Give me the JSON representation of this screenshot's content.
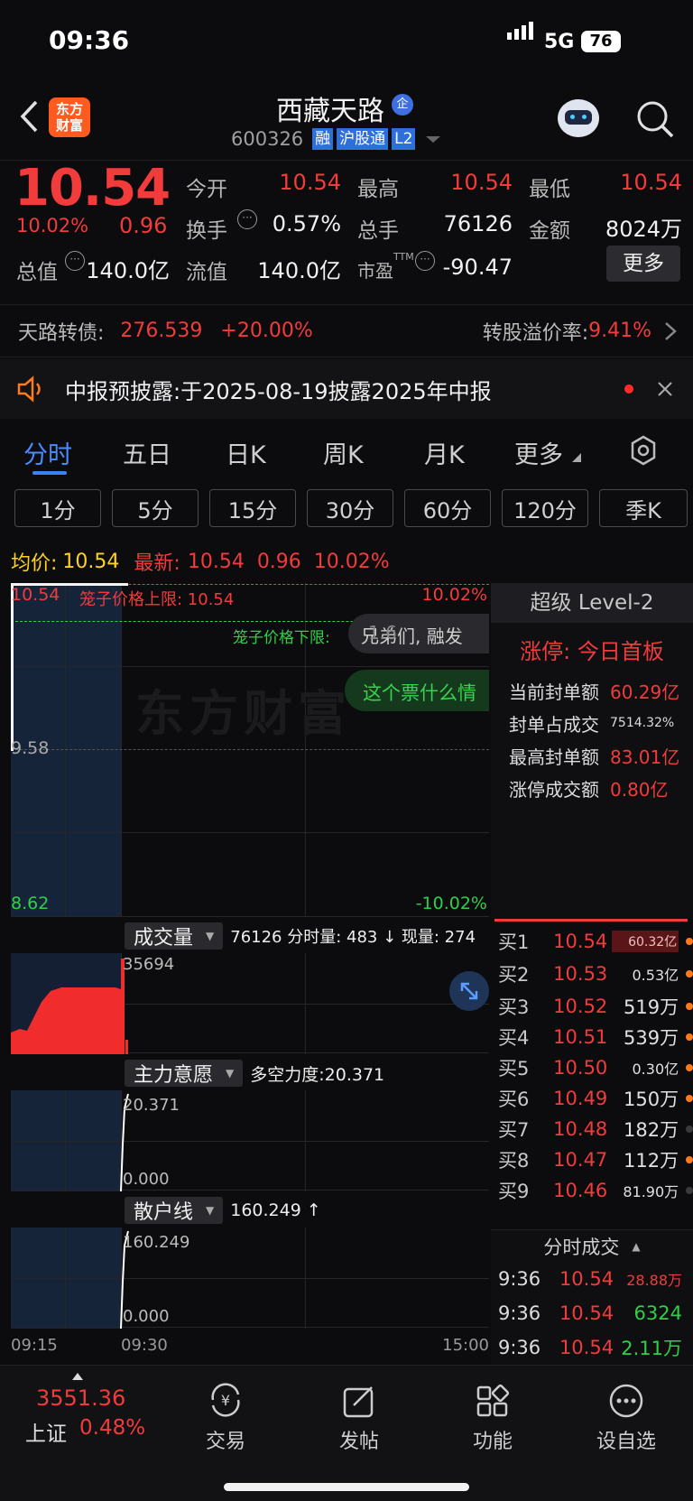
{
  "status": {
    "time": "09:36",
    "network": "5G",
    "battery": "76"
  },
  "nav": {
    "title": "西藏天路",
    "code": "600326",
    "badges": [
      "融",
      "沪股通",
      "L2"
    ],
    "logo_text_1": "东方",
    "logo_text_2": "财富"
  },
  "quote": {
    "price": "10.54",
    "pct": "10.02%",
    "change": "0.96",
    "open_label": "今开",
    "open": "10.54",
    "high_label": "最高",
    "high": "10.54",
    "low_label": "最低",
    "low": "10.54",
    "turnover_label": "换手",
    "turnover": "0.57%",
    "volume_label": "总手",
    "volume": "76126",
    "amount_label": "金额",
    "amount": "8024万",
    "mktcap_label": "总值",
    "mktcap": "140.0亿",
    "float_label": "流值",
    "float": "140.0亿",
    "pe_label": "市盈",
    "pe_sup": "TTM",
    "pe": "-90.47",
    "more_button": "更多"
  },
  "bond": {
    "label": "天路转债:",
    "price": "276.539",
    "pct": "+20.00%",
    "premium_label": "转股溢价率:",
    "premium": "9.41%"
  },
  "notice": {
    "text": "中报预披露:于2025-08-19披露2025年中报"
  },
  "tabs": [
    "分时",
    "五日",
    "日K",
    "周K",
    "月K",
    "更多"
  ],
  "periods": [
    "1分",
    "5分",
    "15分",
    "30分",
    "60分",
    "120分",
    "季K"
  ],
  "summary": {
    "avg_label": "均价:",
    "avg": "10.54",
    "latest_label": "最新:",
    "latest": "10.54",
    "change": "0.96",
    "pct": "10.02%"
  },
  "price_chart": {
    "y_top": "10.54",
    "y_mid": "9.58",
    "y_bottom": "8.62",
    "pct_top": "10.02%",
    "pct_bottom": "-10.02%",
    "cage_upper": "笼子价格上限: 10.54",
    "cage_lower": "笼子价格下限:",
    "watermark": "东方财富",
    "bubble_1": "兄弟们, 融发",
    "bubble_1_behind": "1.6",
    "bubble_2": "这个票什么情"
  },
  "level2": {
    "title": "超级 Level-2",
    "limit_status": "涨停: 今日首板",
    "rows": [
      {
        "label": "当前封单额",
        "value": "60.29亿"
      },
      {
        "label": "封单占成交",
        "value": "7514.32%"
      },
      {
        "label": "最高封单额",
        "value": "83.01亿"
      },
      {
        "label": "涨停成交额",
        "value": "0.80亿"
      }
    ]
  },
  "volume_panel": {
    "selector": "成交量",
    "info": "76126 分时量: 483 ↓ 现量: 274",
    "axis_top": "35694"
  },
  "main_panel": {
    "selector": "主力意愿",
    "info": "多空力度:20.371",
    "axis_top": "20.371",
    "axis_bottom": "0.000"
  },
  "retail_panel": {
    "selector": "散户线",
    "info": "160.249 ↑",
    "axis_top": "160.249",
    "axis_bottom": "0.000"
  },
  "time_axis": [
    "09:15",
    "09:30",
    "15:00"
  ],
  "orderbook": [
    {
      "label": "买1",
      "price": "10.54",
      "vol": "60.32亿",
      "dot": "#ff7a1a",
      "hl": true
    },
    {
      "label": "买2",
      "price": "10.53",
      "vol": "0.53亿",
      "dot": "#ff7a1a"
    },
    {
      "label": "买3",
      "price": "10.52",
      "vol": "519万",
      "dot": "#ff7a1a"
    },
    {
      "label": "买4",
      "price": "10.51",
      "vol": "539万",
      "dot": "#ff7a1a"
    },
    {
      "label": "买5",
      "price": "10.50",
      "vol": "0.30亿",
      "dot": "#ff7a1a"
    },
    {
      "label": "买6",
      "price": "10.49",
      "vol": "150万",
      "dot": "#ff7a1a"
    },
    {
      "label": "买7",
      "price": "10.48",
      "vol": "182万",
      "dot": "#3a3a3a"
    },
    {
      "label": "买8",
      "price": "10.47",
      "vol": "112万",
      "dot": "#ff7a1a"
    },
    {
      "label": "买9",
      "price": "10.46",
      "vol": "81.90万",
      "dot": "#3a3a3a"
    }
  ],
  "ticks_title": "分时成交",
  "ticks": [
    {
      "time": "9:36",
      "price": "10.54",
      "vol": "28.88万"
    },
    {
      "time": "9:36",
      "price": "10.54",
      "vol": "6324"
    },
    {
      "time": "9:36",
      "price": "10.54",
      "vol": "2.11万"
    }
  ],
  "bottom": {
    "index_value": "3551.36",
    "index_name": "上证",
    "index_pct": "0.48%",
    "items": [
      "交易",
      "发帖",
      "功能",
      "设自选"
    ]
  }
}
